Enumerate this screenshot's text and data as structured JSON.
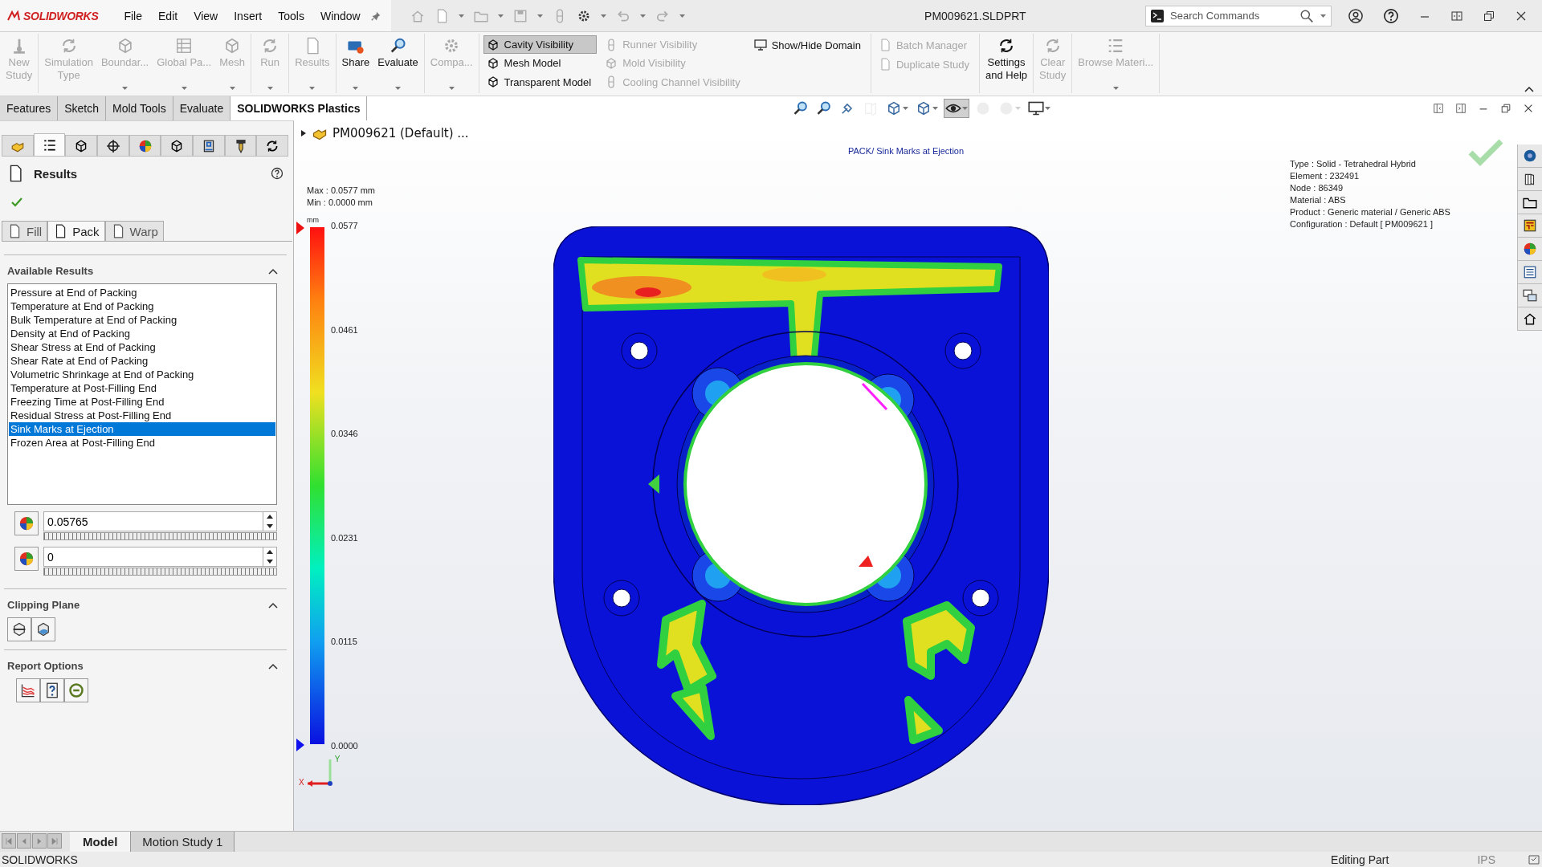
{
  "app": {
    "logo": "SOLIDWORKS",
    "menu": [
      "File",
      "Edit",
      "View",
      "Insert",
      "Tools",
      "Window"
    ],
    "title": "PM009621.SLDPRT",
    "search": {
      "placeholder": "Search Commands"
    }
  },
  "ribbon": [
    {
      "items": [
        {
          "kind": "large",
          "label": "New\nStudy",
          "disabled": true,
          "dropdown": false
        }
      ]
    },
    {
      "items": [
        {
          "kind": "large",
          "label": "Simulation\nType",
          "disabled": true,
          "dropdown": false
        },
        {
          "kind": "large",
          "label": "Boundar...",
          "disabled": true,
          "dropdown": true
        },
        {
          "kind": "large",
          "label": "Global Pa...",
          "disabled": true,
          "dropdown": true
        },
        {
          "kind": "large",
          "label": "Mesh",
          "disabled": true,
          "dropdown": true
        }
      ]
    },
    {
      "items": [
        {
          "kind": "large",
          "label": "Run",
          "disabled": true,
          "dropdown": true
        }
      ]
    },
    {
      "items": [
        {
          "kind": "large",
          "label": "Results",
          "disabled": true,
          "dropdown": true
        }
      ]
    },
    {
      "items": [
        {
          "kind": "large",
          "label": "Share",
          "disabled": false,
          "dropdown": true
        },
        {
          "kind": "large",
          "label": "Evaluate",
          "disabled": false,
          "dropdown": true
        }
      ]
    },
    {
      "items": [
        {
          "kind": "large",
          "label": "Compa...",
          "disabled": true,
          "dropdown": true
        }
      ]
    },
    {
      "items": [
        {
          "kind": "stack",
          "entries": [
            {
              "label": "Cavity Visibility",
              "disabled": false,
              "selected": true
            },
            {
              "label": "Mesh Model",
              "disabled": false,
              "selected": false
            },
            {
              "label": "Transparent Model",
              "disabled": false,
              "selected": false
            }
          ]
        },
        {
          "kind": "stack",
          "entries": [
            {
              "label": "Runner Visibility",
              "disabled": true,
              "selected": false
            },
            {
              "label": "Mold Visibility",
              "disabled": true,
              "selected": false
            },
            {
              "label": "Cooling Channel Visibility",
              "disabled": true,
              "selected": false
            }
          ]
        },
        {
          "kind": "stack",
          "entries": [
            {
              "label": "Show/Hide Domain",
              "disabled": false,
              "selected": false
            }
          ]
        }
      ]
    },
    {
      "items": [
        {
          "kind": "stack",
          "entries": [
            {
              "label": "Batch Manager",
              "disabled": true,
              "selected": false
            },
            {
              "label": "Duplicate Study",
              "disabled": true,
              "selected": false
            }
          ]
        }
      ]
    },
    {
      "items": [
        {
          "kind": "large",
          "label": "Settings\nand Help",
          "disabled": false,
          "dropdown": false
        }
      ]
    },
    {
      "items": [
        {
          "kind": "large",
          "label": "Clear\nStudy",
          "disabled": true,
          "dropdown": false
        }
      ]
    },
    {
      "items": [
        {
          "kind": "large",
          "label": "Browse Materi...",
          "disabled": true,
          "dropdown": true
        }
      ]
    }
  ],
  "tabs": [
    {
      "label": "Features",
      "selected": false
    },
    {
      "label": "Sketch",
      "selected": false
    },
    {
      "label": "Mold Tools",
      "selected": false
    },
    {
      "label": "Evaluate",
      "selected": false
    },
    {
      "label": "SOLIDWORKS Plastics",
      "selected": true
    }
  ],
  "panel": {
    "tabs": [
      {
        "selected": false
      },
      {
        "selected": true
      },
      {
        "selected": false
      },
      {
        "selected": false
      },
      {
        "selected": false
      },
      {
        "selected": false
      },
      {
        "selected": false
      },
      {
        "selected": false
      },
      {
        "selected": false
      }
    ],
    "title": "Results",
    "result_tabs": [
      {
        "label": "Fill",
        "selected": false
      },
      {
        "label": "Pack",
        "selected": true
      },
      {
        "label": "Warp",
        "selected": false
      }
    ],
    "available": {
      "title": "Available Results",
      "expanded": true,
      "items": [
        {
          "label": "Pressure at End of Packing",
          "selected": false
        },
        {
          "label": "Temperature at End of Packing",
          "selected": false
        },
        {
          "label": "Bulk Temperature at End of Packing",
          "selected": false
        },
        {
          "label": "Density at End of Packing",
          "selected": false
        },
        {
          "label": "Shear Stress at End of Packing",
          "selected": false
        },
        {
          "label": "Shear Rate at End of Packing",
          "selected": false
        },
        {
          "label": "Volumetric Shrinkage at End of Packing",
          "selected": false
        },
        {
          "label": "Temperature at Post-Filling End",
          "selected": false
        },
        {
          "label": "Freezing Time at Post-Filling End",
          "selected": false
        },
        {
          "label": "Residual Stress at Post-Filling End",
          "selected": false
        },
        {
          "label": "Sink Marks at Ejection",
          "selected": true
        },
        {
          "label": "Frozen Area at Post-Filling End",
          "selected": false
        }
      ]
    },
    "max_value": "0.05765",
    "min_value": "0",
    "clipping": {
      "title": "Clipping Plane",
      "expanded": true
    },
    "report": {
      "title": "Report Options",
      "expanded": true
    }
  },
  "viewport": {
    "view_toolbar": [
      {
        "pressed": false,
        "disabled": false
      },
      {
        "pressed": false,
        "disabled": false
      },
      {
        "pressed": false,
        "disabled": false
      },
      {
        "pressed": false,
        "disabled": true
      },
      {
        "pressed": false,
        "disabled": false
      },
      {
        "pressed": false,
        "disabled": false
      },
      {
        "pressed": true,
        "disabled": false
      },
      {
        "pressed": false,
        "disabled": true
      },
      {
        "pressed": false,
        "disabled": true
      },
      {
        "pressed": false,
        "disabled": false
      }
    ],
    "tree_item": "PM009621 (Default) ...",
    "plot_title": "PACK/ Sink Marks at Ejection",
    "max": "Max : 0.0577 mm",
    "min": "Min : 0.0000 mm",
    "legend": {
      "unit": "mm",
      "labels": [
        "0.0577",
        "0.0461",
        "0.0346",
        "0.0231",
        "0.0115",
        "0.0000"
      ]
    },
    "info": [
      "Type : Solid - Tetrahedral Hybrid",
      "Element : 232491",
      "Node : 86349",
      "Material : ABS",
      "Product : Generic material / Generic ABS",
      "Configuration : Default [ PM009621 ]"
    ],
    "triad": {
      "x": "X",
      "y": "Y"
    }
  },
  "bottom_tabs": [
    {
      "label": "Model",
      "selected": true
    },
    {
      "label": "Motion Study 1",
      "selected": false
    }
  ],
  "status": {
    "left": "SOLIDWORKS",
    "mode": "Editing Part",
    "units": "IPS"
  }
}
